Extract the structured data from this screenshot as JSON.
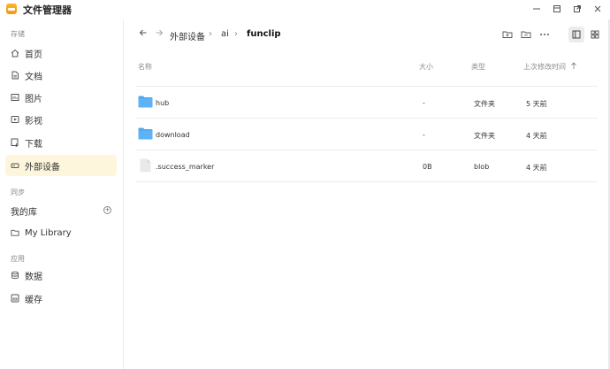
{
  "app": {
    "title": "文件管理器"
  },
  "window": {
    "buttons": [
      "minimize",
      "maximize",
      "restore",
      "close"
    ]
  },
  "sidebar": {
    "sections": [
      {
        "label": "存储",
        "items": [
          {
            "label": "首页",
            "icon": "home-icon"
          },
          {
            "label": "文档",
            "icon": "document-icon"
          },
          {
            "label": "图片",
            "icon": "image-icon"
          },
          {
            "label": "影视",
            "icon": "video-icon"
          },
          {
            "label": "下载",
            "icon": "download-icon"
          },
          {
            "label": "外部设备",
            "icon": "drive-icon",
            "active": true
          }
        ]
      },
      {
        "label": "同步",
        "library_title": "我的库",
        "items": [
          {
            "label": "My Library",
            "icon": "folder-icon"
          }
        ]
      },
      {
        "label": "应用",
        "items": [
          {
            "label": "数据",
            "icon": "database-icon"
          },
          {
            "label": "缓存",
            "icon": "cache-icon"
          }
        ]
      }
    ]
  },
  "breadcrumb": [
    "外部设备",
    "ai",
    "funclip"
  ],
  "table": {
    "headers": {
      "name": "名称",
      "size": "大小",
      "type": "类型",
      "modified": "上次修改时间"
    },
    "rows": [
      {
        "name": "hub",
        "size": "-",
        "type": "文件夹",
        "modified": "5 天前",
        "icon": "folder-icon"
      },
      {
        "name": "download",
        "size": "-",
        "type": "文件夹",
        "modified": "4 天前",
        "icon": "folder-icon"
      },
      {
        "name": ".success_marker",
        "size": "0B",
        "type": "blob",
        "modified": "4 天前",
        "icon": "file-icon"
      }
    ]
  },
  "colors": {
    "accent": "#f5a623",
    "folder": "#4ea7ef",
    "active_bg": "#fdf6dc"
  }
}
